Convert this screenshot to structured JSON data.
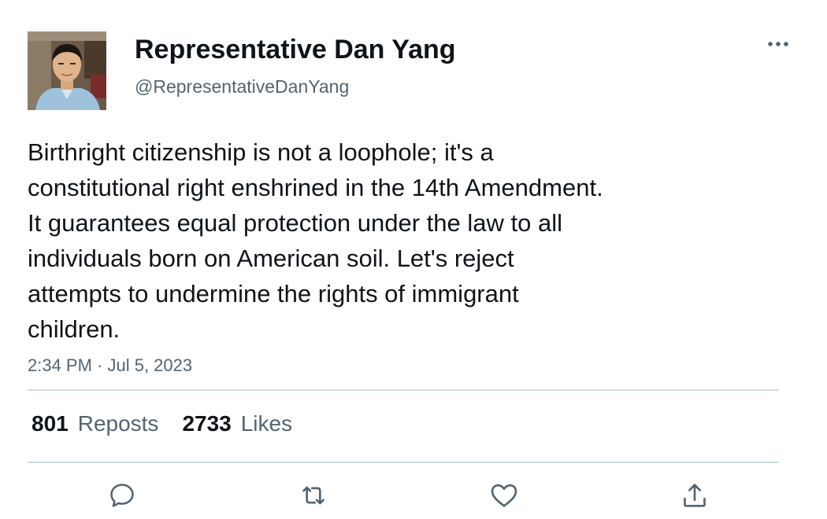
{
  "tweet": {
    "author": {
      "display_name": "Representative Dan Yang",
      "handle": "@RepresentativeDanYang"
    },
    "text_lines": [
      "Birthright citizenship is not a loophole; it's a",
      "constitutional right enshrined in the 14th Amendment.",
      "It guarantees equal protection under the law to all",
      "individuals born on American soil. Let's reject",
      "attempts to undermine the rights of immigrant",
      "children."
    ],
    "timestamp": "2:34 PM · Jul 5, 2023",
    "stats": {
      "reposts_count": "801",
      "reposts_label": "Reposts",
      "likes_count": "2733",
      "likes_label": "Likes"
    }
  },
  "icons": {
    "more": "more-icon",
    "reply": "reply-icon",
    "repost": "repost-icon",
    "like": "heart-icon",
    "share": "share-icon"
  },
  "colors": {
    "primary_text": "#0f1419",
    "secondary_text": "#536471",
    "divider": "#cfd9de",
    "icon": "#536471"
  }
}
